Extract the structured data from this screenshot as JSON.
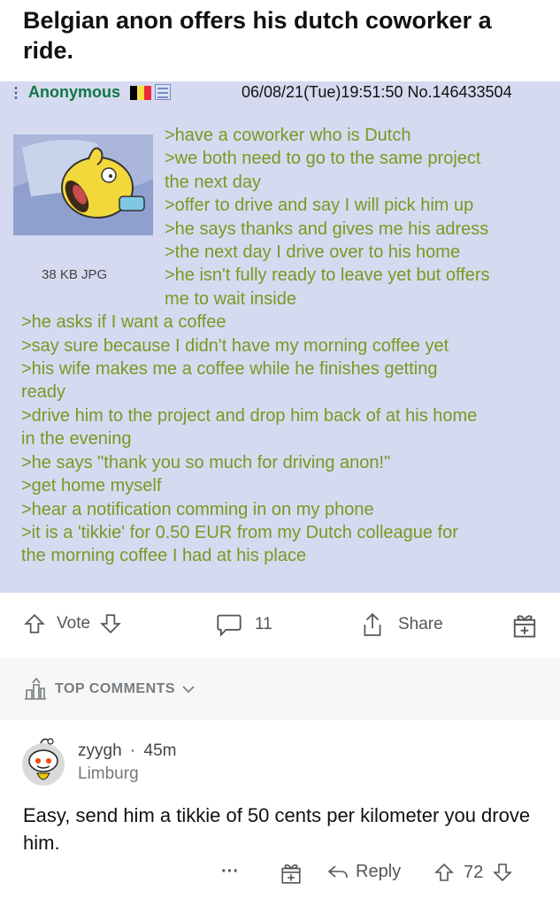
{
  "title": "Belgian anon offers his dutch coworker a ride.",
  "post": {
    "author": "Anonymous",
    "datetime_no": "06/08/21(Tue)19:51:50 No.146433504",
    "file_info": "38 KB JPG",
    "lines_beside_image": [
      ">have a coworker who is Dutch",
      ">we both need to go to the same project",
      "the next day",
      ">offer to drive and say I will pick him up",
      ">he says thanks and gives me his adress",
      ">the next day I drive over to his home",
      ">he isn't fully ready to leave yet but offers",
      "me to wait inside"
    ],
    "lines_full": [
      ">he asks if I want a coffee",
      ">say sure because I didn't have my morning coffee yet",
      ">his wife makes me a coffee while he finishes getting",
      "ready",
      ">drive him to the project and drop him back of at his home",
      "in the evening",
      ">he says \"thank you so much for driving anon!\"",
      ">get home myself",
      ">hear a notification comming in on my phone",
      ">it is a 'tikkie' for 0.50 EUR from my Dutch colleague for",
      "the morning coffee I had at his place"
    ],
    "colors": {
      "background": "#d6daf0",
      "greentext": "#789922",
      "name": "#117743"
    }
  },
  "actions": {
    "vote_label": "Vote",
    "comments_count": "11",
    "share_label": "Share"
  },
  "top_comments_label": "TOP COMMENTS",
  "comment": {
    "username": "zyygh",
    "age": "45m",
    "flair": "Limburg",
    "text": "Easy, send him a tikkie of 50 cents per kilometer you drove him.",
    "more": "···",
    "reply_label": "Reply",
    "score": "72"
  }
}
